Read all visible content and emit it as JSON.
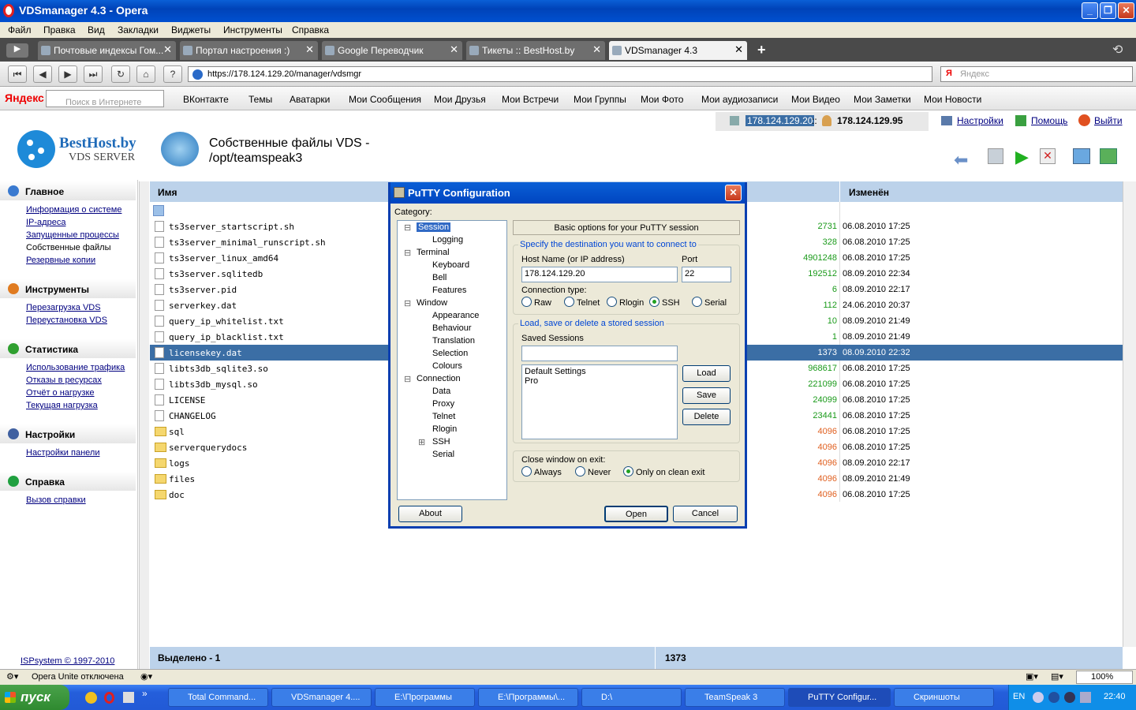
{
  "window": {
    "title": "VDSmanager 4.3 - Opera"
  },
  "menu": [
    "Файл",
    "Правка",
    "Вид",
    "Закладки",
    "Виджеты",
    "Инструменты",
    "Справка"
  ],
  "tabs": [
    {
      "label": "Почтовые индексы Гом..."
    },
    {
      "label": "Портал настроения :)"
    },
    {
      "label": "Google Переводчик"
    },
    {
      "label": "Тикеты :: BestHost.by"
    },
    {
      "label": "VDSmanager 4.3"
    }
  ],
  "address": {
    "url": "https://178.124.129.20/manager/vdsmgr",
    "search_placeholder": "Яндекс"
  },
  "yandex_bar": {
    "logo": "Яндекс",
    "search_placeholder": "Поиск в Интернете",
    "items": [
      "ВКонтакте",
      "Темы",
      "Аватарки",
      "Мои Сообщения",
      "Мои Друзья",
      "Мои Встречи",
      "Мои Группы",
      "Мои Фото",
      "Мои аудиозаписи",
      "Мои Видео",
      "Мои Заметки",
      "Мои Новости"
    ]
  },
  "header": {
    "ip_selected": "178.124.129.20",
    "ip_sep": "::",
    "ip_user": "178.124.129.95",
    "settings": "Настройки",
    "help": "Помощь",
    "logout": "Выйти",
    "brand_name": "BestHost.by",
    "brand_sub": "VDS SERVER",
    "page_title_1": "Собственные файлы VDS -",
    "page_title_2": "/opt/teamspeak3"
  },
  "sidebar": [
    {
      "title": "Главное",
      "color": "#3a7ad0",
      "links": [
        {
          "label": "Информация о системе",
          "link": true
        },
        {
          "label": "IP-адреса",
          "link": true
        },
        {
          "label": "Запущенные процессы",
          "link": true
        },
        {
          "label": "Собственные файлы",
          "link": false
        },
        {
          "label": "Резервные копии",
          "link": true
        }
      ]
    },
    {
      "title": "Инструменты",
      "color": "#e07b20",
      "links": [
        {
          "label": "Перезагрузка VDS",
          "link": true
        },
        {
          "label": "Переустановка VDS",
          "link": true
        }
      ]
    },
    {
      "title": "Статистика",
      "color": "#30a030",
      "links": [
        {
          "label": "Использование трафика",
          "link": true
        },
        {
          "label": "Отказы в ресурсах",
          "link": true
        },
        {
          "label": "Отчёт о нагрузке",
          "link": true
        },
        {
          "label": "Текущая нагрузка",
          "link": true
        }
      ]
    },
    {
      "title": "Настройки",
      "color": "#4060a0",
      "links": [
        {
          "label": "Настройки панели",
          "link": true
        }
      ]
    },
    {
      "title": "Справка",
      "color": "#20a040",
      "links": [
        {
          "label": "Вызов справки",
          "link": true
        }
      ]
    }
  ],
  "copyright": "ISPsystem © 1997-2010",
  "table": {
    "col_name": "Имя",
    "col_changed": "Изменён",
    "rows": [
      {
        "name": "ts3server_startscript.sh",
        "size": "2731",
        "date": "06.08.2010 17:25",
        "dir": false
      },
      {
        "name": "ts3server_minimal_runscript.sh",
        "size": "328",
        "date": "06.08.2010 17:25",
        "dir": false
      },
      {
        "name": "ts3server_linux_amd64",
        "size": "4901248",
        "date": "06.08.2010 17:25",
        "dir": false
      },
      {
        "name": "ts3server.sqlitedb",
        "size": "192512",
        "date": "08.09.2010 22:34",
        "dir": false
      },
      {
        "name": "ts3server.pid",
        "size": "6",
        "date": "08.09.2010 22:17",
        "dir": false
      },
      {
        "name": "serverkey.dat",
        "size": "112",
        "date": "24.06.2010 20:37",
        "dir": false
      },
      {
        "name": "query_ip_whitelist.txt",
        "size": "10",
        "date": "08.09.2010 21:49",
        "dir": false
      },
      {
        "name": "query_ip_blacklist.txt",
        "size": "1",
        "date": "08.09.2010 21:49",
        "dir": false
      },
      {
        "name": "licensekey.dat",
        "size": "1373",
        "date": "08.09.2010 22:32",
        "dir": false,
        "selected": true
      },
      {
        "name": "libts3db_sqlite3.so",
        "size": "968617",
        "date": "06.08.2010 17:25",
        "dir": false
      },
      {
        "name": "libts3db_mysql.so",
        "size": "221099",
        "date": "06.08.2010 17:25",
        "dir": false
      },
      {
        "name": "LICENSE",
        "size": "24099",
        "date": "06.08.2010 17:25",
        "dir": false
      },
      {
        "name": "CHANGELOG",
        "size": "23441",
        "date": "06.08.2010 17:25",
        "dir": false
      },
      {
        "name": "sql",
        "size": "4096",
        "date": "06.08.2010 17:25",
        "dir": true
      },
      {
        "name": "serverquerydocs",
        "size": "4096",
        "date": "06.08.2010 17:25",
        "dir": true
      },
      {
        "name": "logs",
        "size": "4096",
        "date": "08.09.2010 22:17",
        "dir": true
      },
      {
        "name": "files",
        "size": "4096",
        "date": "08.09.2010 21:49",
        "dir": true
      },
      {
        "name": "doc",
        "size": "4096",
        "date": "06.08.2010 17:25",
        "dir": true
      }
    ],
    "footer_label": "Выделено - 1",
    "footer_size": "1373"
  },
  "colors": {
    "file_size": "#1a9a1a",
    "dir_size": "#e06020",
    "selected_row": "#3b6ea5",
    "header_bg": "#bcd2ea"
  },
  "status": {
    "unite": "Opera Unite отключена",
    "zoom": "100%"
  },
  "taskbar": {
    "start": "пуск",
    "items": [
      "Total Command...",
      "VDSmanager 4....",
      "E:\\Программы",
      "E:\\Программы\\...",
      "D:\\",
      "TeamSpeak 3",
      "PuTTY Configur...",
      "Скриншоты"
    ],
    "lang": "EN",
    "time": "22:40"
  },
  "putty": {
    "title": "PuTTY Configuration",
    "category_label": "Category:",
    "tree": [
      {
        "label": "Session",
        "level": 0,
        "exp": "-",
        "selected": true
      },
      {
        "label": "Logging",
        "level": 1
      },
      {
        "label": "Terminal",
        "level": 0,
        "exp": "-"
      },
      {
        "label": "Keyboard",
        "level": 1
      },
      {
        "label": "Bell",
        "level": 1
      },
      {
        "label": "Features",
        "level": 1
      },
      {
        "label": "Window",
        "level": 0,
        "exp": "-"
      },
      {
        "label": "Appearance",
        "level": 1
      },
      {
        "label": "Behaviour",
        "level": 1
      },
      {
        "label": "Translation",
        "level": 1
      },
      {
        "label": "Selection",
        "level": 1
      },
      {
        "label": "Colours",
        "level": 1
      },
      {
        "label": "Connection",
        "level": 0,
        "exp": "-"
      },
      {
        "label": "Data",
        "level": 1
      },
      {
        "label": "Proxy",
        "level": 1
      },
      {
        "label": "Telnet",
        "level": 1
      },
      {
        "label": "Rlogin",
        "level": 1
      },
      {
        "label": "SSH",
        "level": 1,
        "exp": "+"
      },
      {
        "label": "Serial",
        "level": 1
      }
    ],
    "header": "Basic options for your PuTTY session",
    "dest_title": "Specify the destination you want to connect to",
    "host_label": "Host Name (or IP address)",
    "host_value": "178.124.129.20",
    "port_label": "Port",
    "port_value": "22",
    "conn_type_label": "Connection type:",
    "conn_types": [
      {
        "label": "Raw",
        "on": false
      },
      {
        "label": "Telnet",
        "on": false
      },
      {
        "label": "Rlogin",
        "on": false
      },
      {
        "label": "SSH",
        "on": true
      },
      {
        "label": "Serial",
        "on": false
      }
    ],
    "sessions_title": "Load, save or delete a stored session",
    "saved_label": "Saved Sessions",
    "saved_value": "",
    "sessions": [
      "Default Settings",
      "Pro"
    ],
    "load": "Load",
    "save": "Save",
    "delete": "Delete",
    "close_label": "Close window on exit:",
    "close_opts": [
      {
        "label": "Always",
        "on": false
      },
      {
        "label": "Never",
        "on": false
      },
      {
        "label": "Only on clean exit",
        "on": true
      }
    ],
    "about": "About",
    "open": "Open",
    "cancel": "Cancel"
  }
}
